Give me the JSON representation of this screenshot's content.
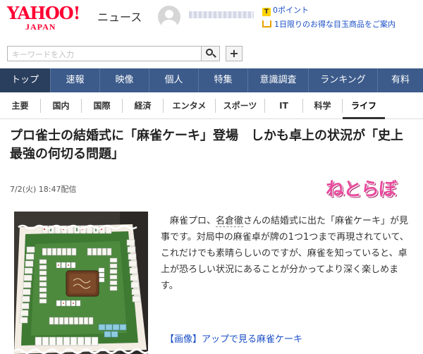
{
  "header": {
    "logo_main": "YAHOO!",
    "logo_sub": "JAPAN",
    "logo_news": "ニュース",
    "points": "0ポイント",
    "points_icon_letter": "T",
    "promo": "1日限りのお得な目玉商品をご案内"
  },
  "search": {
    "placeholder": "キーワードを入力",
    "plus_label": "+"
  },
  "categories": [
    "トップ",
    "速報",
    "映像",
    "個人",
    "特集",
    "意識調査",
    "ランキング",
    "有料"
  ],
  "subcategories": [
    "主要",
    "国内",
    "国際",
    "経済",
    "エンタメ",
    "スポーツ",
    "IT",
    "科学",
    "ライフ"
  ],
  "active_subcategory": "ライフ",
  "article": {
    "headline": "プロ雀士の結婚式に「麻雀ケーキ」登場　しかも卓上の状況が「史上最強の何切る問題」",
    "date": "7/2(火) 18:47配信",
    "source": "ねとらぼ",
    "lede_before": "麻雀プロ、",
    "lede_link": "名倉徹",
    "lede_after": "さんの結婚式に出た「麻雀ケーキ」が見事です。対局中の麻雀卓が牌の1つ1つまで再現されていて、これだけでも素晴らしいのですが、麻雀を知っていると、卓上が恐ろしい状況にあることが分かってより深く楽しめます。",
    "gallery_link": "【画像】アップで見る麻雀ケーキ"
  },
  "colors": {
    "yahoo_red": "#ff0033",
    "nav_blue": "#3c5b8b",
    "nav_active": "#2a3e5e",
    "link_blue": "#1a4fc7",
    "source_pink": "#e84a9c"
  }
}
